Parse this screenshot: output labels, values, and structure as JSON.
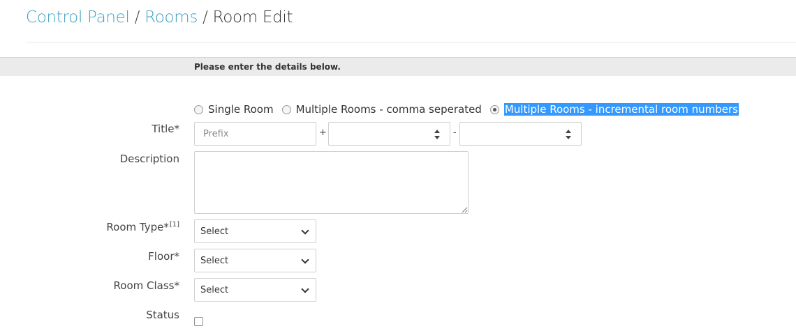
{
  "breadcrumb": {
    "items": [
      "Control Panel",
      "Rooms"
    ],
    "separator": "/",
    "current": "Room Edit"
  },
  "info_bar": {
    "text": "Please enter the details below."
  },
  "room_mode": {
    "options": [
      {
        "label": "Single Room",
        "checked": false
      },
      {
        "label": "Multiple Rooms - comma seperated",
        "checked": false
      },
      {
        "label": "Multiple Rooms - incremental room numbers",
        "checked": true
      }
    ]
  },
  "fields": {
    "title": {
      "label": "Title*",
      "prefix_placeholder": "Prefix",
      "plus": "+",
      "dash": "-"
    },
    "description": {
      "label": "Description"
    },
    "room_type": {
      "label": "Room Type*",
      "footnote": "[1]",
      "value": "Select"
    },
    "floor": {
      "label": "Floor*",
      "value": "Select"
    },
    "room_class": {
      "label": "Room Class*",
      "value": "Select"
    },
    "status": {
      "label": "Status",
      "checked": false
    }
  },
  "colors": {
    "link": "#3a9fc4",
    "selection_highlight": "#3399ff",
    "info_bar_bg": "#ebebeb"
  }
}
